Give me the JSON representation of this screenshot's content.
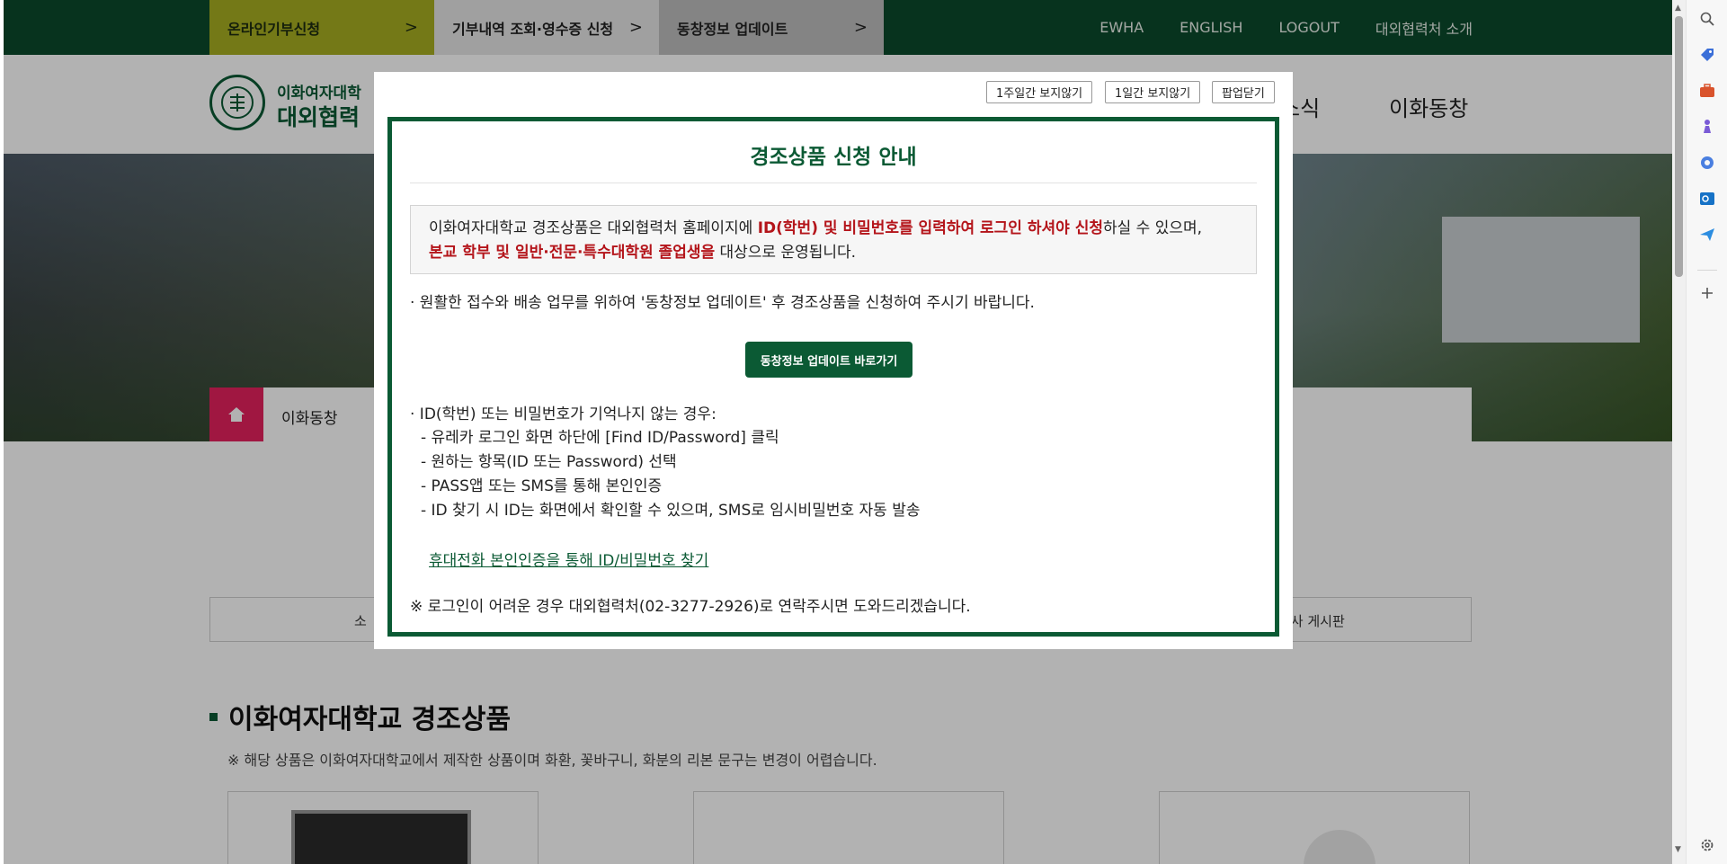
{
  "topbar": {
    "buttons": [
      {
        "label": "온라인기부신청",
        "chevron": ">"
      },
      {
        "label": "기부내역 조회·영수증 신청",
        "chevron": ">"
      },
      {
        "label": "동창정보 업데이트",
        "chevron": ">"
      }
    ],
    "links": [
      "EWHA",
      "ENGLISH",
      "LOGOUT",
      "대외협력처 소개"
    ]
  },
  "header": {
    "logo_line1": "이화여자대학",
    "logo_line2": "대외협력",
    "nav_partial": "소식",
    "nav_last": "이화동창"
  },
  "breadcrumb": {
    "label": "이화동창"
  },
  "tabs": {
    "left_partial": "소",
    "right_partial": "조사 게시판"
  },
  "section": {
    "title": "이화여자대학교 경조상품",
    "note": "※ 해당 상품은 이화여자대학교에서 제작한 상품이며 화환, 꽃바구니, 화분의 리본 문구는 변경이 어렵습니다."
  },
  "popup": {
    "buttons": [
      "1주일간 보지않기",
      "1일간 보지않기",
      "팝업닫기"
    ],
    "title": "경조상품 신청 안내",
    "notice": {
      "p1": "이화여자대학교 경조상품은 대외협력처 홈페이지에 ",
      "p1_red": "ID(학번) 및 비밀번호를 입력하여 로그인 하셔야 신청",
      "p2": "하실 수 있으며,",
      "p3_red": "본교 학부 및 일반·전문·특수대학원 졸업생을",
      "p4": " 대상으로 운영됩니다."
    },
    "line1": "· 원활한 접수와 배송 업무를 위하여 '동창정보 업데이트' 후 경조상품을 신청하여 주시기 바랍니다.",
    "update_button": "동창정보 업데이트 바로가기",
    "id_heading": "· ID(학번) 또는 비밀번호가 기억나지 않는 경우:",
    "steps": [
      "- 유레카 로그인 화면 하단에 [Find ID/Password] 클릭",
      "- 원하는 항목(ID 또는 Password) 선택",
      "- PASS앱 또는 SMS를 통해 본인인증",
      "- ID 찾기 시  ID는 화면에서 확인할 수 있으며, SMS로 임시비밀번호 자동 발송"
    ],
    "find_link": "휴대전화 본인인증을 통해 ID/비밀번호 찾기",
    "contact": "※ 로그인이 어려운 경우 대외협력처(02-3277-2926)로 연락주시면 도와드리겠습니다."
  },
  "colors": {
    "brand_green": "#0b4a2c",
    "accent_olive": "#a6ae22",
    "accent_pink": "#e6215e",
    "alert_red": "#b4141a"
  },
  "icons": {
    "side_panel": [
      "search-icon",
      "tag-icon",
      "briefcase-icon",
      "chess-piece-icon",
      "copilot-icon",
      "outlook-icon",
      "send-icon",
      "add-icon",
      "settings-icon"
    ]
  }
}
